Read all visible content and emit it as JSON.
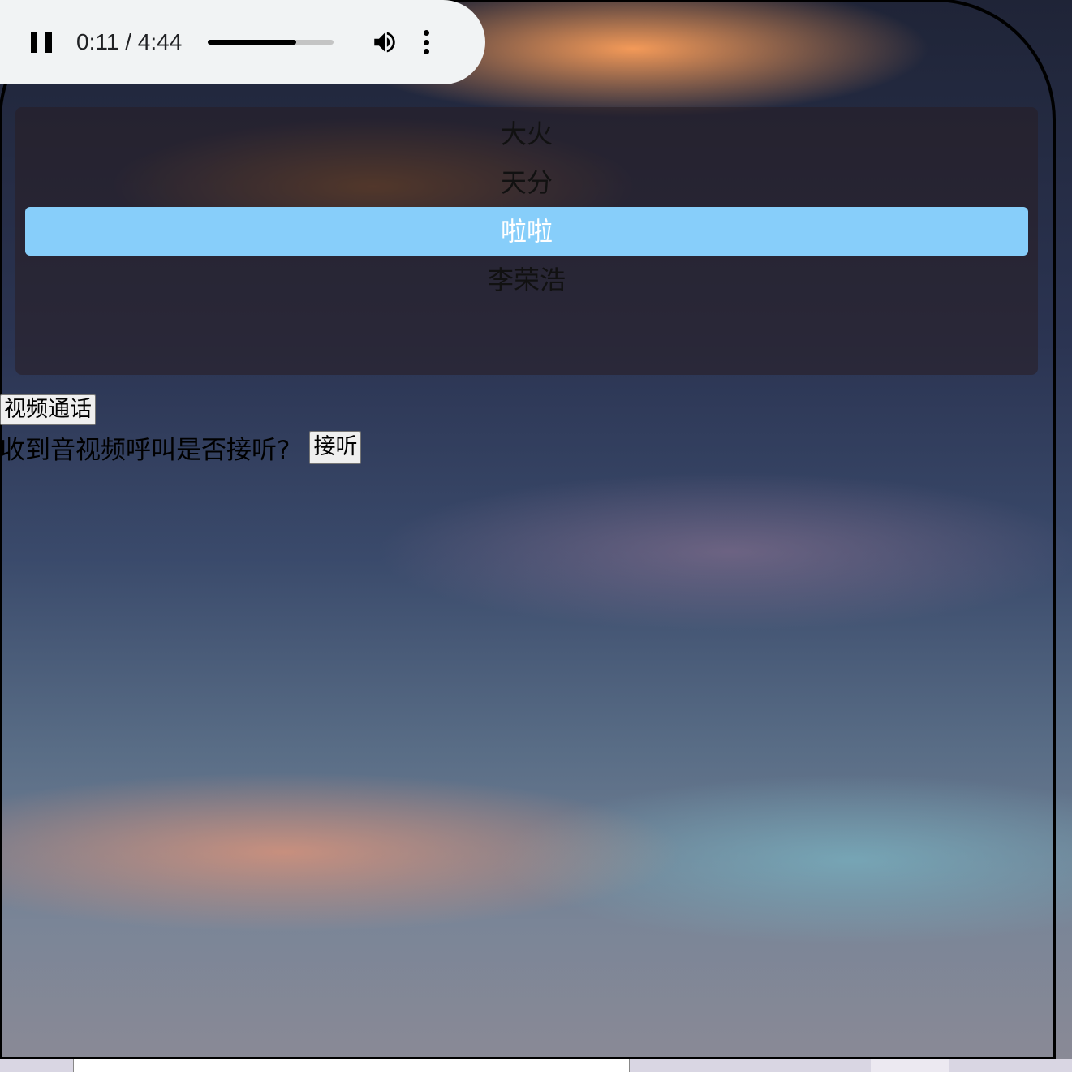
{
  "audio_player": {
    "state": "playing",
    "current_time": "0:11",
    "separator": " / ",
    "duration": "4:44",
    "progress_fraction": 0.7,
    "icons": [
      "pause-icon",
      "volume-icon",
      "more-options-icon"
    ]
  },
  "contacts": {
    "items": [
      {
        "name": "大火"
      },
      {
        "name": "天分"
      },
      {
        "name": "啦啦"
      },
      {
        "name": "李荣浩"
      }
    ],
    "selected_index": 2,
    "selected_color": "#87cefa"
  },
  "actions": {
    "video_call_label": "视频通话",
    "incoming_prompt": "收到音视频呼叫是否接听?",
    "answer_label": "接听"
  }
}
